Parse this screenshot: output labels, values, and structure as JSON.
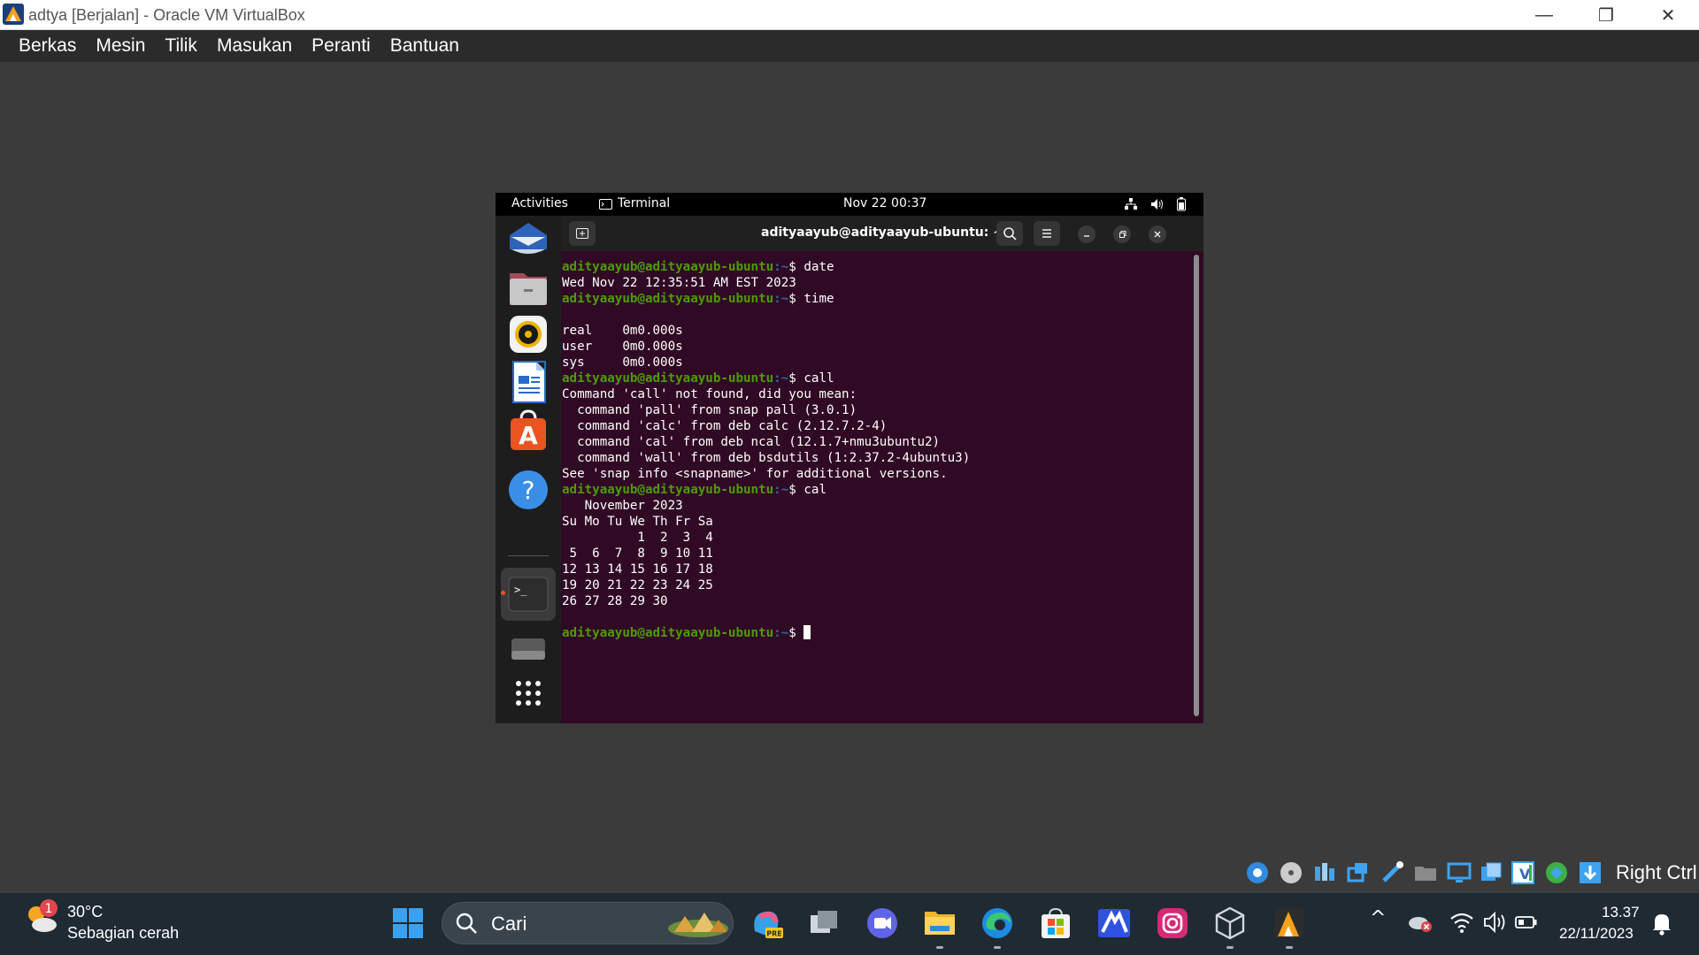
{
  "window": {
    "title": "adtya [Berjalan] - Oracle VM VirtualBox",
    "controls": {
      "minimize": "—",
      "restore": "❐",
      "close": "✕"
    }
  },
  "menubar": {
    "items": [
      "Berkas",
      "Mesin",
      "Tilik",
      "Masukan",
      "Peranti",
      "Bantuan"
    ]
  },
  "guest": {
    "topbar": {
      "activities": "Activities",
      "app_name": "Terminal",
      "datetime": "Nov 22  00:37"
    },
    "dock": {
      "icons": [
        "thunderbird-icon",
        "files-icon",
        "rhythmbox-icon",
        "libreoffice-writer-icon",
        "app-center-icon",
        "help-icon",
        "terminal-icon",
        "drive-icon",
        "show-apps-icon"
      ]
    },
    "terminal": {
      "title": "adityaayub@adityaayub-ubuntu: ~",
      "prompt_user": "adityaayub@adityaayub-ubuntu",
      "prompt_sep": ":~",
      "prompt_symbol": "$ ",
      "lines": [
        {
          "kind": "cmd",
          "text": "date"
        },
        {
          "kind": "out",
          "text": "Wed Nov 22 12:35:51 AM EST 2023"
        },
        {
          "kind": "cmd",
          "text": "time"
        },
        {
          "kind": "out",
          "text": ""
        },
        {
          "kind": "out",
          "text": "real\t0m0.000s"
        },
        {
          "kind": "out",
          "text": "user\t0m0.000s"
        },
        {
          "kind": "out",
          "text": "sys\t0m0.000s"
        },
        {
          "kind": "cmd",
          "text": "call"
        },
        {
          "kind": "out",
          "text": "Command 'call' not found, did you mean:"
        },
        {
          "kind": "out",
          "text": "  command 'pall' from snap pall (3.0.1)"
        },
        {
          "kind": "out",
          "text": "  command 'calc' from deb calc (2.12.7.2-4)"
        },
        {
          "kind": "out",
          "text": "  command 'cal' from deb ncal (12.1.7+nmu3ubuntu2)"
        },
        {
          "kind": "out",
          "text": "  command 'wall' from deb bsdutils (1:2.37.2-4ubuntu3)"
        },
        {
          "kind": "out",
          "text": "See 'snap info <snapname>' for additional versions."
        },
        {
          "kind": "cmd",
          "text": "cal"
        },
        {
          "kind": "out",
          "text": "   November 2023"
        },
        {
          "kind": "out",
          "text": "Su Mo Tu We Th Fr Sa"
        },
        {
          "kind": "out",
          "text": "          1  2  3  4"
        },
        {
          "kind": "out",
          "text": " 5  6  7  8  9 10 11"
        },
        {
          "kind": "out",
          "text": "12 13 14 15 16 17 18"
        },
        {
          "kind": "out",
          "text": "19 20 21 22 23 24 25"
        },
        {
          "kind": "out",
          "text": "26 27 28 29 30"
        },
        {
          "kind": "out",
          "text": ""
        },
        {
          "kind": "prompt",
          "text": ""
        }
      ]
    }
  },
  "vbox_status": {
    "host_key": "Right Ctrl",
    "icons": [
      "hard-disk-icon",
      "optical-drive-icon",
      "audio-icon",
      "network-icon",
      "usb-icon",
      "shared-folders-icon",
      "display-icon",
      "recording-icon",
      "vt-x-icon",
      "mouse-integration-icon",
      "keyboard-capture-icon"
    ]
  },
  "taskbar": {
    "weather": {
      "temp": "30°C",
      "desc": "Sebagian cerah",
      "badge": "1"
    },
    "search_placeholder": "Cari",
    "copilot_badge": "PRE",
    "clock": {
      "time": "13.37",
      "date": "22/11/2023"
    },
    "tray_chevron": "^"
  },
  "colors": {
    "terminal_bg": "#300a24",
    "prompt_user": "#4e9a06",
    "prompt_path": "#3465a4",
    "taskbar_bg": "#1f2a33"
  }
}
